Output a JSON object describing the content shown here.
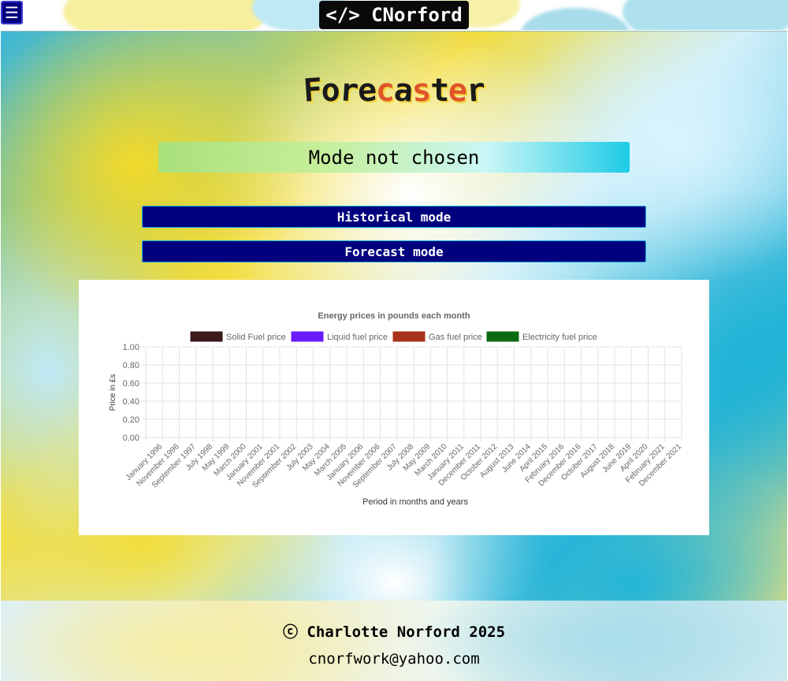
{
  "header": {
    "menu_icon": "hamburger-icon",
    "menu_glyph": "☰",
    "logo_text": "</> CNorford"
  },
  "main": {
    "title": "Forecaster",
    "title_letter_colors": [
      "#1a1a1a",
      "#1a1a1a",
      "#1a1a1a",
      "#1a1a1a",
      "#e0552a",
      "#1a1a1a",
      "#e0552a",
      "#1a1a1a",
      "#e0552a",
      "#1a1a1a"
    ],
    "mode_status": "Mode not chosen",
    "buttons": {
      "historical": "Historical mode",
      "forecast": "Forecast mode"
    }
  },
  "chart_data": {
    "type": "line",
    "title": "Energy prices in pounds each month",
    "xlabel": "Period in months and years",
    "ylabel": "Price in £s",
    "ylim": [
      0,
      1
    ],
    "y_ticks": [
      "0.00",
      "0.20",
      "0.40",
      "0.60",
      "0.80",
      "1.00"
    ],
    "categories": [
      "January 1996",
      "November 1996",
      "September 1997",
      "July 1998",
      "May 1999",
      "March 2000",
      "January 2001",
      "November 2001",
      "September 2002",
      "July 2003",
      "May 2004",
      "March 2005",
      "January 2006",
      "November 2006",
      "September 2007",
      "July 2008",
      "May 2009",
      "March 2010",
      "January 2011",
      "December 2011",
      "October 2012",
      "August 2013",
      "June 2014",
      "April 2015",
      "February 2016",
      "December 2016",
      "October 2017",
      "August 2018",
      "June 2019",
      "April 2020",
      "February 2021",
      "December 2021"
    ],
    "series": [
      {
        "name": "Solid Fuel price",
        "color": "#3a1a1a",
        "values": []
      },
      {
        "name": "Liquid fuel price",
        "color": "#6a1cff",
        "values": []
      },
      {
        "name": "Gas fuel price",
        "color": "#a8321a",
        "values": []
      },
      {
        "name": "Electricity fuel price",
        "color": "#0c6a12",
        "values": []
      }
    ],
    "grid": true,
    "legend": "top"
  },
  "footer": {
    "copyright": "ⓒ Charlotte Norford 2025",
    "email": "cnorfwork@yahoo.com"
  }
}
